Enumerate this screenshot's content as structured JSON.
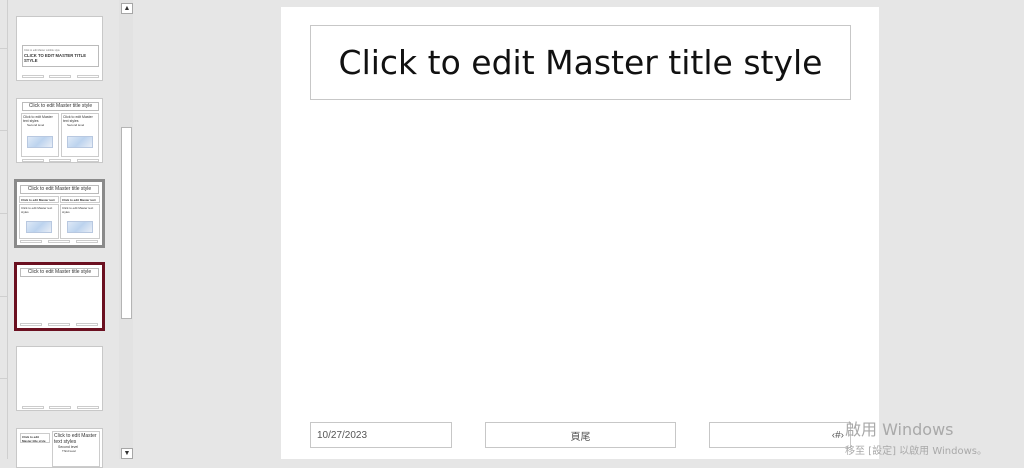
{
  "thumbnail_pane": {
    "thumbs": [
      {
        "title": "CLICK TO EDIT MASTER TITLE STYLE",
        "subtitle": "Click to edit Master subtitle style"
      },
      {
        "title": "Click to edit Master title style",
        "left_text": "Click to edit Master text styles",
        "right_text": "Click to edit Master text styles",
        "bullet": "Second level"
      },
      {
        "title": "Click to edit Master title style",
        "left_head": "Click to edit Master text styles",
        "right_head": "Click to edit Master text styles",
        "left_text": "Click to edit Master text styles",
        "right_text": "Click to edit Master text styles"
      },
      {
        "title": "Click to edit Master title style"
      },
      {},
      {
        "left_head": "Click to edit Master title style",
        "right_text": "Click to edit Master text styles",
        "bullet": "Second level",
        "bullet2": "Third level"
      }
    ],
    "scroll_up": "▲",
    "scroll_down": "▼"
  },
  "slide": {
    "title": "Click to edit Master title style",
    "date": "10/27/2023",
    "footer": "頁尾",
    "slide_number": "‹#›"
  },
  "watermark": {
    "line1": "啟用 Windows",
    "line2": "移至 [設定] 以啟用 Windows。"
  }
}
